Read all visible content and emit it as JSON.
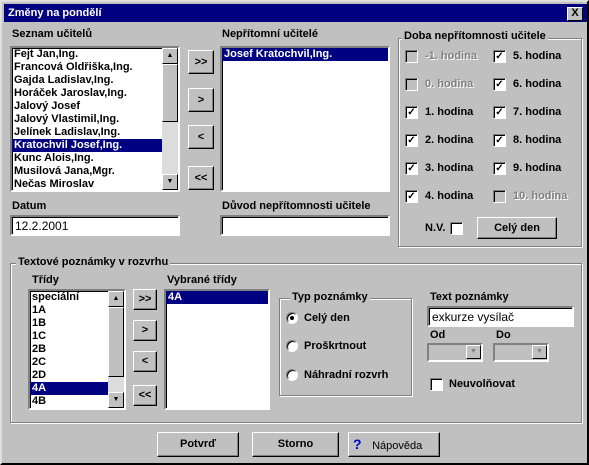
{
  "window": {
    "title": "Změny na pondělí",
    "close_label": "X"
  },
  "teachers": {
    "label": "Seznam učitelů",
    "items": [
      "Fejt Jan,Ing.",
      "Francová Oldřiška,Ing.",
      "Gajda Ladislav,Ing.",
      "Horáček Jaroslav,Ing.",
      "Jalový Josef",
      "Jalový Vlastimil,Ing.",
      "Jelínek Ladislav,Ing.",
      "Kratochvil Josef,Ing.",
      "Kunc Alois,Ing.",
      "Musilová Jana,Mgr.",
      "Nečas Miroslav"
    ],
    "selected": "Kratochvil Josef,Ing."
  },
  "move_buttons": {
    "add_all": ">>",
    "add": ">",
    "remove": "<",
    "remove_all": "<<"
  },
  "absent": {
    "label": "Nepřítomní učitelé",
    "items": [
      "Josef Kratochvil,Ing."
    ]
  },
  "absence_hours": {
    "label": "Doba nepřítomnosti učitele",
    "hours": [
      {
        "label": "-1. hodina",
        "checked": false,
        "enabled": false
      },
      {
        "label": "0. hodina",
        "checked": false,
        "enabled": false
      },
      {
        "label": "1. hodina",
        "checked": true,
        "enabled": true
      },
      {
        "label": "2. hodina",
        "checked": true,
        "enabled": true
      },
      {
        "label": "3. hodina",
        "checked": true,
        "enabled": true
      },
      {
        "label": "4. hodina",
        "checked": true,
        "enabled": true
      },
      {
        "label": "5. hodina",
        "checked": true,
        "enabled": true
      },
      {
        "label": "6. hodina",
        "checked": true,
        "enabled": true
      },
      {
        "label": "7. hodina",
        "checked": true,
        "enabled": true
      },
      {
        "label": "8. hodina",
        "checked": true,
        "enabled": true
      },
      {
        "label": "9. hodina",
        "checked": true,
        "enabled": true
      },
      {
        "label": "10. hodina",
        "checked": false,
        "enabled": false
      }
    ],
    "nv_label": "N.V.",
    "whole_day_button": "Celý den"
  },
  "date": {
    "label": "Datum",
    "value": "12.2.2001"
  },
  "reason": {
    "label": "Důvod nepřítomnosti učitele",
    "value": ""
  },
  "notes": {
    "label": "Textové poznámky v rozvrhu",
    "classes_label": "Třídy",
    "classes": [
      "speciální",
      "1A",
      "1B",
      "1C",
      "2B",
      "2C",
      "2D",
      "4A",
      "4B"
    ],
    "selected_class": "4A",
    "selected_classes_label": "Vybrané třídy",
    "selected_classes": [
      "4A"
    ],
    "note_type": {
      "label": "Typ poznámky",
      "options": [
        "Celý den",
        "Proškrtnout",
        "Náhradní rozvrh"
      ],
      "selected_index": 0
    },
    "note_text_label": "Text poznámky",
    "note_text": "exkurze vysílač",
    "from_label": "Od",
    "to_label": "Do",
    "no_release_label": "Neuvolňovat"
  },
  "footer": {
    "confirm": "Potvrď",
    "cancel": "Storno",
    "help": "Nápověda"
  }
}
